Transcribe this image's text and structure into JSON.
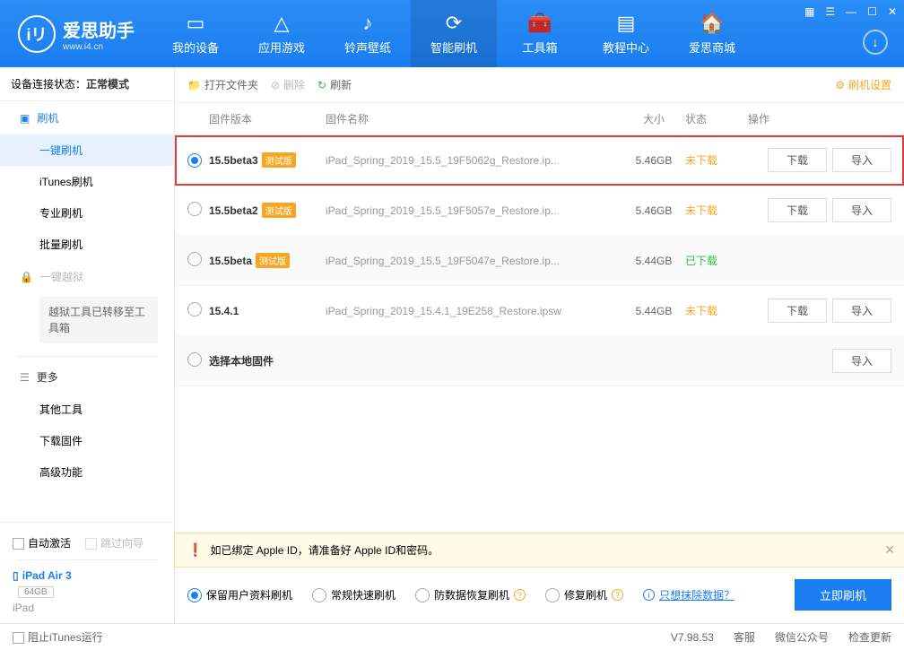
{
  "logo": {
    "name": "爱思助手",
    "sub": "www.i4.cn"
  },
  "tabs": [
    {
      "label": "我的设备",
      "icon": "phone"
    },
    {
      "label": "应用游戏",
      "icon": "apps"
    },
    {
      "label": "铃声壁纸",
      "icon": "music"
    },
    {
      "label": "智能刷机",
      "icon": "refresh",
      "active": true
    },
    {
      "label": "工具箱",
      "icon": "toolbox"
    },
    {
      "label": "教程中心",
      "icon": "book"
    },
    {
      "label": "爱思商城",
      "icon": "store"
    }
  ],
  "sidebar": {
    "conn_label": "设备连接状态：",
    "conn_value": "正常模式",
    "flash_head": "刷机",
    "flash_items": [
      "一键刷机",
      "iTunes刷机",
      "专业刷机",
      "批量刷机"
    ],
    "jailbreak": "一键越狱",
    "jailbreak_note": "越狱工具已转移至工具箱",
    "more": "更多",
    "more_items": [
      "其他工具",
      "下载固件",
      "高级功能"
    ],
    "auto_activate": "自动激活",
    "skip_guide": "跳过向导",
    "device_name": "iPad Air 3",
    "device_cap": "64GB",
    "device_model": "iPad"
  },
  "toolbar": {
    "open": "打开文件夹",
    "delete": "删除",
    "refresh": "刷新",
    "settings": "刷机设置"
  },
  "columns": {
    "version": "固件版本",
    "name": "固件名称",
    "size": "大小",
    "status": "状态",
    "ops": "操作"
  },
  "rows": [
    {
      "selected": true,
      "version": "15.5beta3",
      "beta": "测试版",
      "name": "iPad_Spring_2019_15.5_19F5062g_Restore.ip...",
      "size": "5.46GB",
      "status": "未下载",
      "status_type": "not",
      "download": true,
      "import": true
    },
    {
      "selected": false,
      "version": "15.5beta2",
      "beta": "测试版",
      "name": "iPad_Spring_2019_15.5_19F5057e_Restore.ip...",
      "size": "5.46GB",
      "status": "未下载",
      "status_type": "not",
      "download": true,
      "import": true
    },
    {
      "selected": false,
      "version": "15.5beta",
      "beta": "测试版",
      "name": "iPad_Spring_2019_15.5_19F5047e_Restore.ip...",
      "size": "5.44GB",
      "status": "已下载",
      "status_type": "done",
      "download": false,
      "import": false
    },
    {
      "selected": false,
      "version": "15.4.1",
      "beta": "",
      "name": "iPad_Spring_2019_15.4.1_19E258_Restore.ipsw",
      "size": "5.44GB",
      "status": "未下载",
      "status_type": "not",
      "download": true,
      "import": true
    },
    {
      "selected": false,
      "version": "选择本地固件",
      "beta": "",
      "name": "",
      "size": "",
      "status": "",
      "status_type": "",
      "download": false,
      "import": true
    }
  ],
  "btn_download": "下载",
  "btn_import": "导入",
  "alert": "如已绑定 Apple ID，请准备好 Apple ID和密码。",
  "options": [
    {
      "label": "保留用户资料刷机",
      "on": true,
      "help": false
    },
    {
      "label": "常规快速刷机",
      "on": false,
      "help": false
    },
    {
      "label": "防数据恢复刷机",
      "on": false,
      "help": true
    },
    {
      "label": "修复刷机",
      "on": false,
      "help": true
    }
  ],
  "erase_link": "只想抹除数据？",
  "flash_btn": "立即刷机",
  "status": {
    "block_itunes": "阻止iTunes运行",
    "version": "V7.98.53",
    "service": "客服",
    "wechat": "微信公众号",
    "update": "检查更新"
  }
}
